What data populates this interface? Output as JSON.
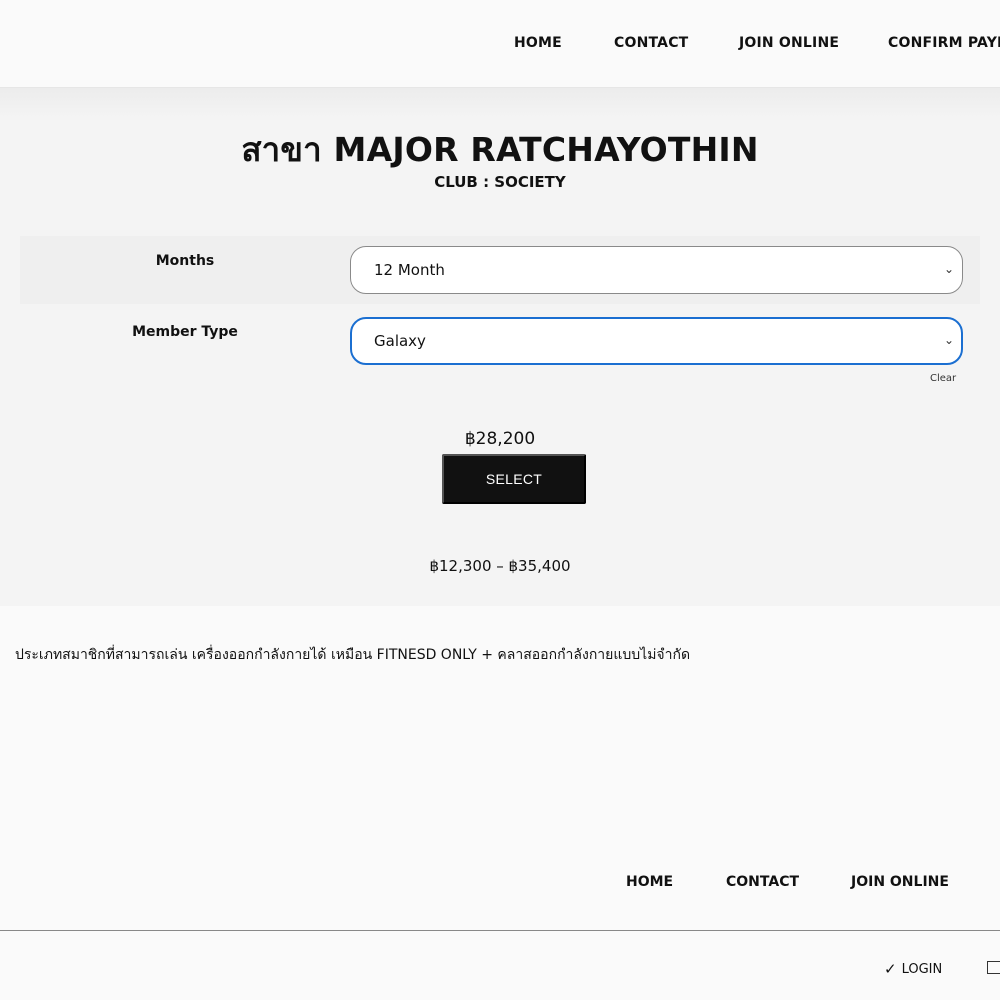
{
  "header": {
    "nav": [
      "HOME",
      "CONTACT",
      "JOIN ONLINE",
      "CONFIRM PAYM"
    ]
  },
  "branch": {
    "title": "สาขา MAJOR RATCHAYOTHIN",
    "club": "CLUB : SOCIETY"
  },
  "form": {
    "months_label": "Months",
    "months_value": "12 Month",
    "member_type_label": "Member Type",
    "member_type_value": "Galaxy",
    "clear_label": "Clear"
  },
  "pricing": {
    "price": "฿28,200",
    "select_label": "SELECT",
    "range": "฿12,300 – ฿35,400"
  },
  "description": "ประเภทสมาชิกที่สามารถเล่น เครื่องออกกำลังกายได้ เหมือน FITNESD ONLY + คลาสออกกำลังกายแบบไม่จำกัด",
  "footer": {
    "nav": [
      "HOME",
      "CONTACT",
      "JOIN ONLINE"
    ],
    "login_label": "LOGIN"
  },
  "icons": {
    "chevron": "chevron-down-icon",
    "login": "check-icon",
    "cart": "register-icon"
  },
  "colors": {
    "accent": "#1b6fd1",
    "button": "#111111"
  }
}
